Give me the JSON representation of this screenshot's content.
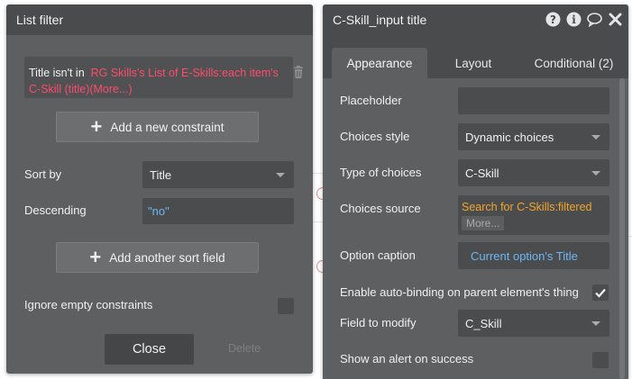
{
  "list_filter": {
    "title": "List filter",
    "constraint_label": "Title isn't in",
    "constraint_expression": "RG Skills's List of E-Skills:each item's C-Skill (title)(More...)",
    "add_constraint_label": "Add a new constraint",
    "sort_by_label": "Sort by",
    "sort_by_value": "Title",
    "descending_label": "Descending",
    "descending_value": "\"no\"",
    "add_sort_label": "Add another sort field",
    "ignore_empty_label": "Ignore empty constraints",
    "ignore_empty_checked": false,
    "close_label": "Close",
    "delete_label": "Delete"
  },
  "inspector": {
    "title": "C-Skill_input title",
    "header_icons": [
      "help-icon",
      "info-icon",
      "comment-icon",
      "close-icon"
    ],
    "tabs": [
      {
        "label": "Appearance",
        "active": true
      },
      {
        "label": "Layout",
        "active": false
      },
      {
        "label": "Conditional (2)",
        "active": false
      }
    ],
    "placeholder_label": "Placeholder",
    "placeholder_value": "",
    "choices_style_label": "Choices style",
    "choices_style_value": "Dynamic choices",
    "type_of_choices_label": "Type of choices",
    "type_of_choices_value": "C-Skill",
    "choices_source_label": "Choices source",
    "choices_source_value": "Search for C-Skills:filtered",
    "choices_source_more": "More...",
    "option_caption_label": "Option caption",
    "option_caption_value": "Current option's Title",
    "auto_binding_label": "Enable auto-binding on parent element's thing",
    "auto_binding_checked": true,
    "field_to_modify_label": "Field to modify",
    "field_to_modify_value": "C_Skill",
    "show_alert_label": "Show an alert on success",
    "show_alert_checked": false
  },
  "colors": {
    "panel_bg": "#5d5f60",
    "header_bg": "#494b4c",
    "expression_red": "#ff4b6e",
    "expression_orange": "#f3a52e",
    "expression_blue": "#6eb6f7"
  }
}
